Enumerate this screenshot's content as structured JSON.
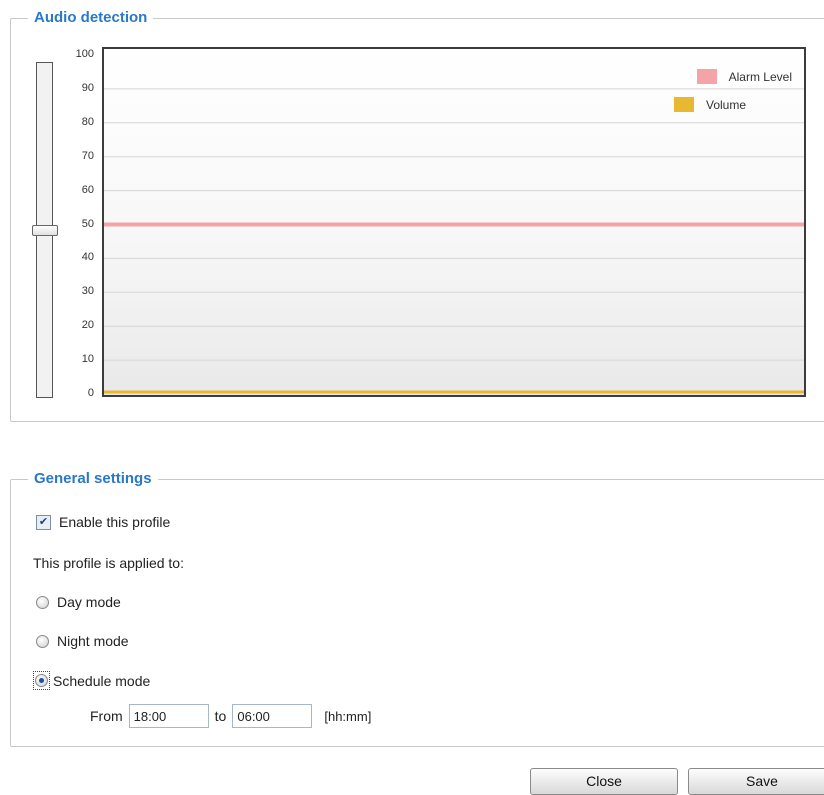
{
  "audio_detection": {
    "title": "Audio detection",
    "slider_value": 50,
    "y_ticks": [
      "100",
      "90",
      "80",
      "70",
      "60",
      "50",
      "40",
      "30",
      "20",
      "10",
      "0"
    ]
  },
  "chart_data": {
    "type": "line",
    "title": "",
    "ylim": [
      0,
      100
    ],
    "yticks": [
      100,
      90,
      80,
      70,
      60,
      50,
      40,
      30,
      20,
      10,
      0
    ],
    "grid": true,
    "legend_position": "top-right",
    "series": [
      {
        "name": "Alarm Level",
        "color": "#f4a3a8",
        "values": [
          50,
          50
        ]
      },
      {
        "name": "Volume",
        "color": "#e8b830",
        "values": [
          0,
          0
        ]
      }
    ]
  },
  "general_settings": {
    "title": "General settings",
    "enable_label": "Enable this profile",
    "enable_checked": true,
    "applied_to_label": "This profile is applied to:",
    "modes": [
      {
        "label": "Day mode",
        "checked": false
      },
      {
        "label": "Night mode",
        "checked": false
      },
      {
        "label": "Schedule mode",
        "checked": true
      }
    ],
    "from_label": "From",
    "from_value": "18:00",
    "to_label": "to",
    "to_value": "06:00",
    "format_hint": "[hh:mm]"
  },
  "buttons": {
    "close": "Close",
    "save": "Save"
  }
}
